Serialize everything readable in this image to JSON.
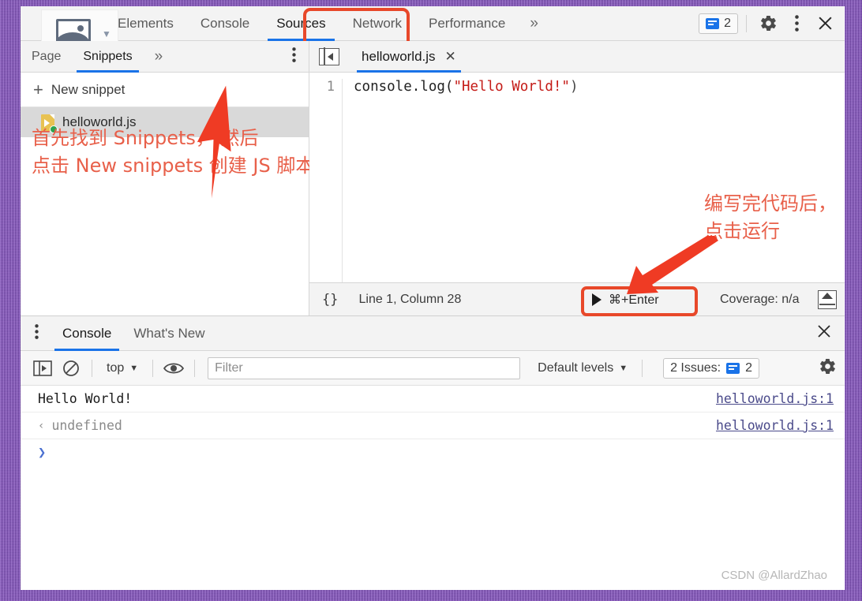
{
  "devtools": {
    "main_tabs": [
      {
        "label": "Elements",
        "active": false
      },
      {
        "label": "Console",
        "active": false
      },
      {
        "label": "Sources",
        "active": true
      },
      {
        "label": "Network",
        "active": false
      },
      {
        "label": "Performance",
        "active": false
      }
    ],
    "more_tabs_icon": "chevron-double-right-icon",
    "issues_count": "2",
    "settings_icon": "gear-icon",
    "overflow_icon": "three-dots-vertical-icon",
    "close_icon": "close-icon"
  },
  "nav_panel": {
    "tabs": [
      {
        "label": "Page",
        "active": false
      },
      {
        "label": "Snippets",
        "active": true
      }
    ],
    "more_icon": "chevron-double-right-icon",
    "overflow_icon": "three-dots-vertical-icon",
    "new_snippet_label": "New snippet",
    "new_snippet_icon": "plus-icon",
    "snippets": [
      {
        "name": "helloworld.js",
        "icon": "js-snippet-file-icon",
        "selected": true
      }
    ]
  },
  "editor": {
    "panel_toggle_icon": "show-navigator-icon",
    "file_tab": {
      "name": "helloworld.js",
      "close_icon": "close-icon"
    },
    "line_number": "1",
    "code": {
      "before_string": "console.log(",
      "string": "\"Hello World!\"",
      "after_string": ")"
    },
    "status": {
      "format_icon": "{}",
      "cursor": "Line 1, Column 28",
      "run_icon": "play-icon",
      "run_label": "⌘+Enter",
      "coverage": "Coverage: n/a",
      "drawer_icon": "show-drawer-icon"
    }
  },
  "drawer": {
    "overflow_icon": "three-dots-vertical-icon",
    "tabs": [
      {
        "label": "Console",
        "active": true
      },
      {
        "label": "What's New",
        "active": false
      }
    ],
    "close_icon": "close-icon",
    "toolbar": {
      "sidebar_icon": "console-sidebar-icon",
      "clear_icon": "clear-console-icon",
      "context_label": "top",
      "context_caret": "▼",
      "eye_icon": "live-expression-eye-icon",
      "filter_placeholder": "Filter",
      "levels_label": "Default levels",
      "levels_caret": "▼",
      "issues_label": "2 Issues:",
      "issues_count": "2",
      "settings_icon": "gear-icon"
    },
    "messages": [
      {
        "type": "log",
        "text": "Hello World!",
        "source": "helloworld.js:1",
        "marker": ""
      },
      {
        "type": "result",
        "text": "undefined",
        "source": "helloworld.js:1",
        "marker": "‹"
      }
    ],
    "prompt": "❯"
  },
  "annotations": {
    "left": {
      "line1": "首先找到 Snippets， 然后",
      "line2": "点击 New snippets 创建 JS 脚本",
      "color": "#e8604a"
    },
    "right": {
      "line1": "编写完代码后，",
      "line2": "点击运行",
      "color": "#e8604a"
    },
    "highlight_color": "#e8482a"
  },
  "watermark": "CSDN @AllardZhao"
}
